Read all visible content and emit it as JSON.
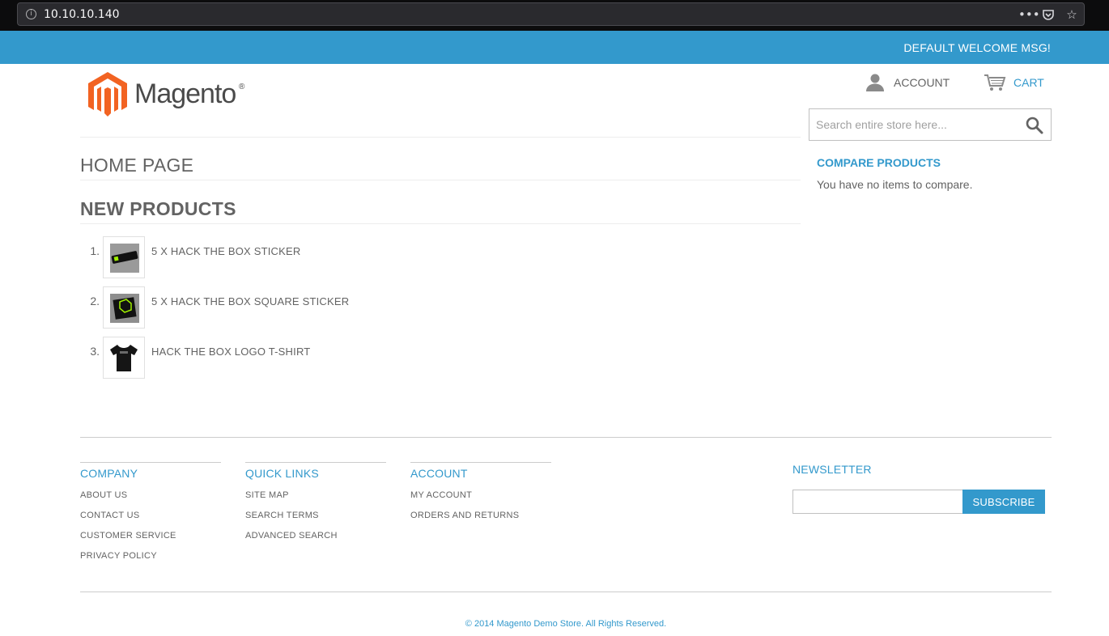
{
  "browser": {
    "url": "10.10.10.140",
    "menu_icon": "ellipsis-icon",
    "pocket_icon": "pocket-icon",
    "bookmark_icon": "star-icon"
  },
  "header": {
    "welcome_msg": "DEFAULT WELCOME MSG!",
    "logo_text": "Magento",
    "logo_reg": "®",
    "account_label": "ACCOUNT",
    "cart_label": "CART",
    "search_placeholder": "Search entire store here..."
  },
  "main": {
    "page_title": "HOME PAGE",
    "section_title": "NEW PRODUCTS",
    "products": [
      {
        "num": "1.",
        "name": "5 X HACK THE BOX STICKER",
        "thumb_icon": "sticker-thumbnail"
      },
      {
        "num": "2.",
        "name": "5 X HACK THE BOX SQUARE STICKER",
        "thumb_icon": "square-sticker-thumbnail"
      },
      {
        "num": "3.",
        "name": "HACK THE BOX LOGO T-SHIRT",
        "thumb_icon": "tshirt-thumbnail"
      }
    ]
  },
  "sidebar": {
    "compare_title": "COMPARE PRODUCTS",
    "compare_empty": "You have no items to compare."
  },
  "footer": {
    "columns": [
      {
        "title": "COMPANY",
        "links": [
          "ABOUT US",
          "CONTACT US",
          "CUSTOMER SERVICE",
          "PRIVACY POLICY"
        ]
      },
      {
        "title": "QUICK LINKS",
        "links": [
          "SITE MAP",
          "SEARCH TERMS",
          "ADVANCED SEARCH"
        ]
      },
      {
        "title": "ACCOUNT",
        "links": [
          "MY ACCOUNT",
          "ORDERS AND RETURNS"
        ]
      }
    ],
    "newsletter_title": "NEWSLETTER",
    "subscribe_label": "SUBSCRIBE",
    "copyright": "© 2014 Magento Demo Store. All Rights Reserved."
  },
  "colors": {
    "accent": "#3399cc",
    "logo_orange": "#f26322",
    "text": "#636363"
  }
}
